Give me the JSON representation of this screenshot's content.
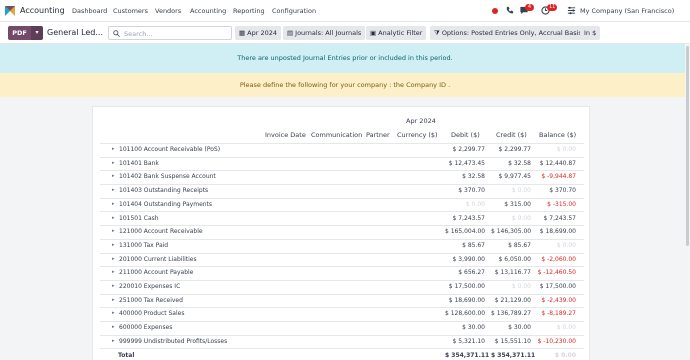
{
  "navbar": {
    "app_name": "Accounting",
    "menu": [
      "Dashboard",
      "Customers",
      "Vendors",
      "Accounting",
      "Reporting",
      "Configuration"
    ],
    "chat_badge": "4",
    "activity_badge": "11",
    "company": "My Company (San Francisco)"
  },
  "controls": {
    "pdf_label": "PDF",
    "title": "General Led...",
    "search_placeholder": "Search...",
    "filters": [
      {
        "icon": "calendar-icon",
        "label": "Apr 2024"
      },
      {
        "icon": "journal-icon",
        "label": "Journals: All Journals"
      },
      {
        "icon": "analytic-icon",
        "label": "Analytic Filter"
      },
      {
        "icon": "filter-icon",
        "label": "Options: Posted Entries Only, Accrual Basis"
      },
      {
        "icon": "",
        "label": "In $"
      }
    ]
  },
  "alerts": {
    "info": "There are unposted Journal Entries prior or included in this period.",
    "warning": "Please define the following for your company : the Company ID ."
  },
  "report": {
    "period": "Apr 2024",
    "columns": [
      "Invoice Date",
      "Communication",
      "Partner",
      "Currency ($)",
      "Debit ($)",
      "Credit ($)",
      "Balance ($)"
    ],
    "rows": [
      {
        "name": "101100 Account Receivable (PoS)",
        "debit": "$ 2,299.77",
        "credit": "$ 2,299.77",
        "balance": "$ 0.00",
        "d0": false,
        "c0": false,
        "b0": true,
        "neg": false
      },
      {
        "name": "101401 Bank",
        "debit": "$ 12,473.45",
        "credit": "$ 32.58",
        "balance": "$ 12,440.87",
        "d0": false,
        "c0": false,
        "b0": false,
        "neg": false
      },
      {
        "name": "101402 Bank Suspense Account",
        "debit": "$ 32.58",
        "credit": "$ 9,977.45",
        "balance": "$ -9,944.87",
        "d0": false,
        "c0": false,
        "b0": false,
        "neg": true
      },
      {
        "name": "101403 Outstanding Receipts",
        "debit": "$ 370.70",
        "credit": "$ 0.00",
        "balance": "$ 370.70",
        "d0": false,
        "c0": true,
        "b0": false,
        "neg": false
      },
      {
        "name": "101404 Outstanding Payments",
        "debit": "$ 0.00",
        "credit": "$ 315.00",
        "balance": "$ -315.00",
        "d0": true,
        "c0": false,
        "b0": false,
        "neg": true
      },
      {
        "name": "101501 Cash",
        "debit": "$ 7,243.57",
        "credit": "$ 0.00",
        "balance": "$ 7,243.57",
        "d0": false,
        "c0": true,
        "b0": false,
        "neg": false
      },
      {
        "name": "121000 Account Receivable",
        "debit": "$ 165,004.00",
        "credit": "$ 146,305.00",
        "balance": "$ 18,699.00",
        "d0": false,
        "c0": false,
        "b0": false,
        "neg": false
      },
      {
        "name": "131000 Tax Paid",
        "debit": "$ 85.67",
        "credit": "$ 85.67",
        "balance": "$ 0.00",
        "d0": false,
        "c0": false,
        "b0": true,
        "neg": false
      },
      {
        "name": "201000 Current Liabilities",
        "debit": "$ 3,990.00",
        "credit": "$ 6,050.00",
        "balance": "$ -2,060.00",
        "d0": false,
        "c0": false,
        "b0": false,
        "neg": true
      },
      {
        "name": "211000 Account Payable",
        "debit": "$ 656.27",
        "credit": "$ 13,116.77",
        "balance": "$ -12,460.50",
        "d0": false,
        "c0": false,
        "b0": false,
        "neg": true
      },
      {
        "name": "220010 Expenses IC",
        "debit": "$ 17,500.00",
        "credit": "$ 0.00",
        "balance": "$ 17,500.00",
        "d0": false,
        "c0": true,
        "b0": false,
        "neg": false
      },
      {
        "name": "251000 Tax Received",
        "debit": "$ 18,690.00",
        "credit": "$ 21,129.00",
        "balance": "$ -2,439.00",
        "d0": false,
        "c0": false,
        "b0": false,
        "neg": true
      },
      {
        "name": "400000 Product Sales",
        "debit": "$ 128,600.00",
        "credit": "$ 136,789.27",
        "balance": "$ -8,189.27",
        "d0": false,
        "c0": false,
        "b0": false,
        "neg": true
      },
      {
        "name": "600000 Expenses",
        "debit": "$ 30.00",
        "credit": "$ 30.00",
        "balance": "$ 0.00",
        "d0": false,
        "c0": false,
        "b0": true,
        "neg": false
      },
      {
        "name": "999999 Undistributed Profits/Losses",
        "debit": "$ 5,321.10",
        "credit": "$ 15,551.10",
        "balance": "$ -10,230.00",
        "d0": false,
        "c0": false,
        "b0": false,
        "neg": true
      }
    ],
    "total": {
      "label": "Total",
      "debit": "$ 354,371.11",
      "credit": "$ 354,371.11",
      "balance": "$ 0.00"
    }
  },
  "colors": {
    "brand": "#714b67",
    "negative": "#dc2626",
    "info_bg": "#cfeff4",
    "warn_bg": "#fdf0c8"
  }
}
